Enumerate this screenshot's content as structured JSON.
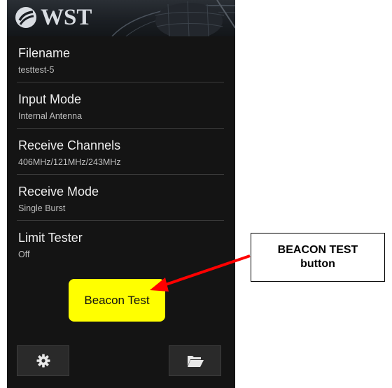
{
  "header": {
    "logo_text": "WST"
  },
  "settings": [
    {
      "title": "Filename",
      "value": "testtest-5"
    },
    {
      "title": "Input Mode",
      "value": "Internal Antenna"
    },
    {
      "title": "Receive Channels",
      "value": "406MHz/121MHz/243MHz"
    },
    {
      "title": "Receive Mode",
      "value": "Single Burst"
    },
    {
      "title": "Limit Tester",
      "value": "Off"
    }
  ],
  "beacon_button": {
    "label": "Beacon Test"
  },
  "bottom_bar": {
    "left_icon": "gear-icon",
    "right_icon": "folder-open-icon"
  },
  "annotation": {
    "line1": "BEACON TEST",
    "line2": "button"
  },
  "colors": {
    "button": "#ffff00",
    "arrow": "#ff0000",
    "background": "#141414"
  }
}
